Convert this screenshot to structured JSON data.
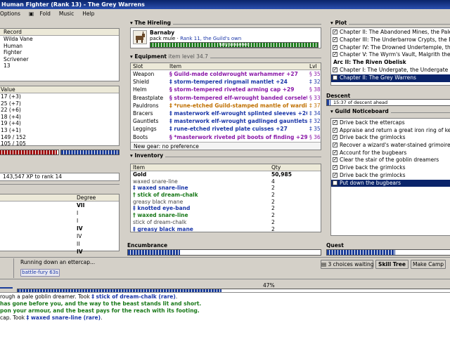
{
  "window": {
    "title": "Human Fighter (Rank 13) - The Grey Warrens"
  },
  "menu": [
    {
      "label": "Options",
      "icon": ""
    },
    {
      "label": "Fold",
      "icon": "fold-icon"
    },
    {
      "label": "Music",
      "icon": ""
    },
    {
      "label": "Help",
      "icon": ""
    }
  ],
  "character": {
    "header": "Record",
    "rows": [
      "Wilda Vane",
      "Human",
      "Fighter",
      "Scrivener",
      "13"
    ]
  },
  "stats": {
    "header": "Value",
    "rows": [
      "17 (+3)",
      "25 (+7)",
      "22 (+6)",
      "18 (+4)",
      "19 (+4)",
      "13 (+1)",
      "149 / 152",
      "105 / 105"
    ]
  },
  "xp": {
    "text": "143,547 XP to rank 14",
    "hp_fill": 0.98,
    "mp_fill": 1.0
  },
  "spells": {
    "header": "Degree",
    "rows": [
      {
        "degree": "VII",
        "bold": true
      },
      {
        "degree": "I",
        "bold": false
      },
      {
        "degree": "I",
        "bold": false
      },
      {
        "degree": "IV",
        "bold": true
      },
      {
        "degree": "IV",
        "bold": false
      },
      {
        "degree": "II",
        "bold": false
      },
      {
        "degree": "IV",
        "bold": true
      }
    ]
  },
  "hireling": {
    "heading": "The Hireling",
    "name": "Barnaby",
    "desc": "pack mule",
    "rank": "Rank 11, the Guild's own",
    "bar_label": "fully seasoned",
    "bar_fill": 1.0
  },
  "equipment": {
    "heading": "Equipment",
    "sub": "item level 34.7",
    "cols": [
      "Slot",
      "Item",
      "Lvl"
    ],
    "rows": [
      {
        "slot": "Weapon",
        "mark": "§",
        "item": "Guild-made coldwrought warhammer +27",
        "lvl": "§ 35",
        "cls": "purple"
      },
      {
        "slot": "Shield",
        "mark": "‡",
        "item": "storm-tempered ringmail mantlet +24",
        "lvl": "‡ 32",
        "cls": "blue"
      },
      {
        "slot": "Helm",
        "mark": "§",
        "item": "storm-tempered riveted arming cap +29",
        "lvl": "§ 38",
        "cls": "purple"
      },
      {
        "slot": "Breastplate",
        "mark": "§",
        "item": "storm-tempered elf-wrought banded corselet ...",
        "lvl": "§ 33",
        "cls": "purple"
      },
      {
        "slot": "Pauldrons",
        "mark": "‡",
        "item": "*rune-etched Guild-stamped mantle of wardin...",
        "lvl": "‡ 37",
        "cls": "orange"
      },
      {
        "slot": "Bracers",
        "mark": "‡",
        "item": "masterwork elf-wrought splinted sleeves +26",
        "lvl": "‡ 34",
        "cls": "blue"
      },
      {
        "slot": "Gauntlets",
        "mark": "‡",
        "item": "masterwork elf-wrought gadlinged gauntlets ...",
        "lvl": "‡ 32",
        "cls": "blue"
      },
      {
        "slot": "Leggings",
        "mark": "‡",
        "item": "rune-etched riveted plate cuisses +27",
        "lvl": "‡ 35",
        "cls": "blue"
      },
      {
        "slot": "Boots",
        "mark": "§",
        "item": "*masterwork riveted pit boots of finding +29",
        "lvl": "§ 36",
        "cls": "purple"
      }
    ],
    "new_gear": "New gear: no preference"
  },
  "inventory": {
    "heading": "Inventory",
    "cols": [
      "Item",
      "Qty"
    ],
    "rows": [
      {
        "item": "Gold",
        "qty": "50,985",
        "cls": "gold"
      },
      {
        "item": "waxed snare-line",
        "qty": "4",
        "cls": "grey"
      },
      {
        "item": "‡ waxed snare-line",
        "qty": "2",
        "cls": "blue"
      },
      {
        "item": "† stick of dream-chalk",
        "qty": "2",
        "cls": "green"
      },
      {
        "item": "greasy black mane",
        "qty": "2",
        "cls": "grey"
      },
      {
        "item": "‡ knotted eye-band",
        "qty": "2",
        "cls": "blue"
      },
      {
        "item": "† waxed snare-line",
        "qty": "2",
        "cls": "green"
      },
      {
        "item": "stick of dream-chalk",
        "qty": "2",
        "cls": "grey"
      },
      {
        "item": "‡ greasy black mane",
        "qty": "2",
        "cls": "blue"
      }
    ]
  },
  "encumbrance": {
    "heading": "Encumbrance",
    "fill": 0.27
  },
  "plot": {
    "heading": "Plot",
    "rows": [
      {
        "label": "Chapter II: The Abandoned Mines, the Pale Forest",
        "checked": true,
        "type": "item"
      },
      {
        "label": "Chapter III: The Underbarrow Crypts, the Barrow...",
        "checked": true,
        "type": "item"
      },
      {
        "label": "Chapter IV: The Drowned Undertemple, the Drowned...",
        "checked": true,
        "type": "item"
      },
      {
        "label": "Chapter V: The Wyrm's Vault, Malgrith the Red...",
        "checked": true,
        "type": "item"
      },
      {
        "label": "Arc II: The Riven Obelisk",
        "checked": false,
        "type": "arc"
      },
      {
        "label": "Chapter I: The Undergate, the Undergate Porter",
        "checked": true,
        "type": "item"
      },
      {
        "label": "Chapter II: The Grey Warrens",
        "checked": false,
        "type": "selected"
      }
    ]
  },
  "descent": {
    "heading": "Descent",
    "text": "15:37 of descent ahead",
    "fill": 0.03
  },
  "guild": {
    "heading": "Guild Noticeboard",
    "rows": [
      {
        "label": "Drive back the ettercaps",
        "checked": true,
        "selected": false
      },
      {
        "label": "Appraise and return a great iron ring of keys",
        "checked": true,
        "selected": false
      },
      {
        "label": "Drive back the grimlocks",
        "checked": true,
        "selected": false
      },
      {
        "label": "Recover a wizard's water-stained grimoire",
        "checked": true,
        "selected": false
      },
      {
        "label": "Account for the bugbears",
        "checked": true,
        "selected": false
      },
      {
        "label": "Clear the stair of the goblin dreamers",
        "checked": true,
        "selected": false
      },
      {
        "label": "Drive back the grimlocks",
        "checked": true,
        "selected": false
      },
      {
        "label": "Drive back the grimlocks",
        "checked": true,
        "selected": false
      },
      {
        "label": "Put down the bugbears",
        "checked": false,
        "selected": true
      }
    ]
  },
  "quest": {
    "heading": "Quest",
    "fill": 0.55
  },
  "status": {
    "activity": "Running down an ettercap...",
    "buff": "battle-fury 63s",
    "choices": "3 choices waiting",
    "skill_tree": "Skill Tree",
    "make_camp": "Make Camp",
    "progress_label": "47%",
    "progress": 0.47
  },
  "log": [
    {
      "segments": [
        {
          "t": "rough a pale goblin dreamer. Took ",
          "c": ""
        },
        {
          "t": "‡ stick of dream-chalk (rare)",
          "c": "blue"
        },
        {
          "t": ".",
          "c": ""
        }
      ]
    },
    {
      "segments": [
        {
          "t": "has gone before you, and the way to the beast stands lit and short.",
          "c": "green"
        }
      ]
    },
    {
      "segments": [
        {
          "t": "pon your armour, and the beast pays for the reach with its footing.",
          "c": "green"
        }
      ]
    },
    {
      "segments": [
        {
          "t": "cap. Took ",
          "c": ""
        },
        {
          "t": "‡ waxed snare-line (rare)",
          "c": "blue"
        },
        {
          "t": ".",
          "c": ""
        }
      ]
    }
  ],
  "colors": {
    "title_bg": "#0a246a",
    "bar_blue": "#1c3e9a",
    "bar_red": "#a01010",
    "bar_green": "#1f7f1f",
    "rare": "#1a36a8",
    "epic": "#8a18a8",
    "legendary": "#c07000",
    "uncommon": "#187818"
  }
}
